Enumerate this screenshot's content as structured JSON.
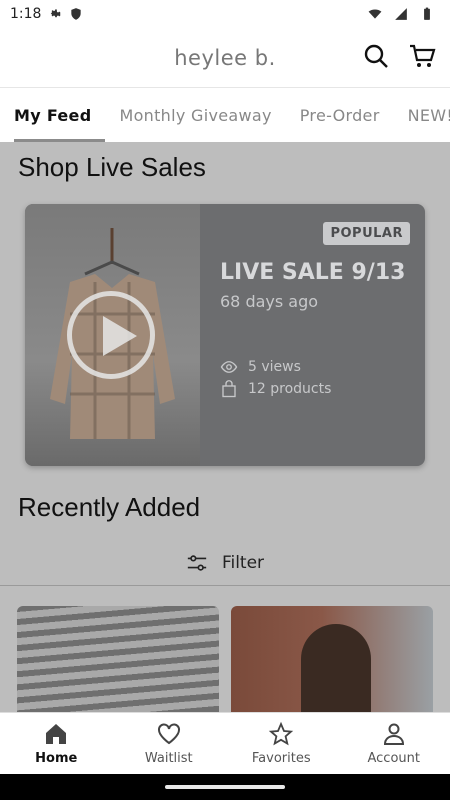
{
  "status_bar": {
    "time": "1:18"
  },
  "header": {
    "brand": "heylee b."
  },
  "tabs": [
    {
      "label": "My Feed"
    },
    {
      "label": "Monthly Giveaway"
    },
    {
      "label": "Pre-Order"
    },
    {
      "label": "NEW!"
    }
  ],
  "live_sales": {
    "section_title": "Shop Live Sales",
    "card": {
      "badge": "POPULAR",
      "title": "LIVE SALE 9/13",
      "age": "68 days ago",
      "views": "5 views",
      "products": "12 products"
    }
  },
  "recently_added": {
    "section_title": "Recently Added",
    "filter_label": "Filter"
  },
  "bottom_nav": [
    {
      "label": "Home",
      "icon": "home-icon"
    },
    {
      "label": "Waitlist",
      "icon": "heart-icon"
    },
    {
      "label": "Favorites",
      "icon": "star-icon"
    },
    {
      "label": "Account",
      "icon": "person-icon"
    }
  ],
  "colors": {
    "card_bg": "#6c6d6f",
    "badge_bg": "#c9cacc",
    "overlay": "#bdbdbd"
  }
}
